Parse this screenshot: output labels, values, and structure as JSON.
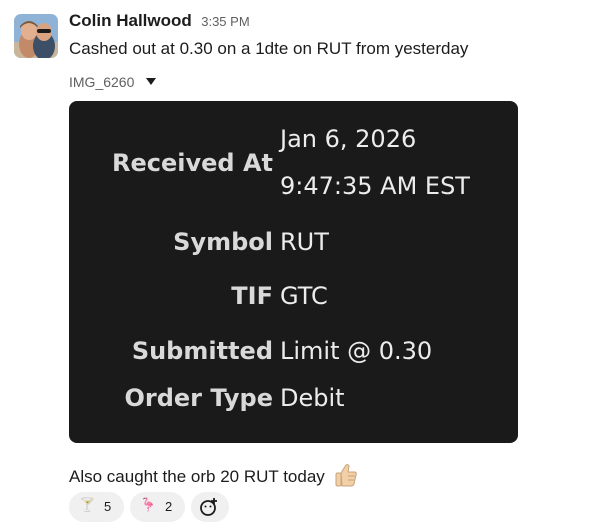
{
  "message": {
    "author": "Colin Hallwood",
    "timestamp": "3:35 PM",
    "text": "Cashed out at 0.30 on a 1dte on RUT from yesterday"
  },
  "attachment": {
    "file_name": "IMG_6260",
    "rows": [
      {
        "label": "Received At",
        "value_line1": "Jan 6, 2026",
        "value_line2": "9:47:35 AM EST"
      },
      {
        "label": "Symbol",
        "value": "RUT"
      },
      {
        "label": "TIF",
        "value": "GTC"
      },
      {
        "label": "Submitted",
        "value": "Limit @ 0.30"
      },
      {
        "label": "Order Type",
        "value": "Debit"
      }
    ]
  },
  "followup": {
    "text": "Also caught the orb 20 RUT today",
    "emoji": "thumbs-up"
  },
  "reactions": [
    {
      "emoji": "cocktail",
      "glyph": "🍸",
      "count": "5"
    },
    {
      "emoji": "flamingo",
      "glyph": "🦩",
      "count": "2"
    }
  ],
  "colors": {
    "card_bg": "#1a1a1a",
    "pill_bg": "#f0f0f0",
    "timestamp": "#616061"
  }
}
